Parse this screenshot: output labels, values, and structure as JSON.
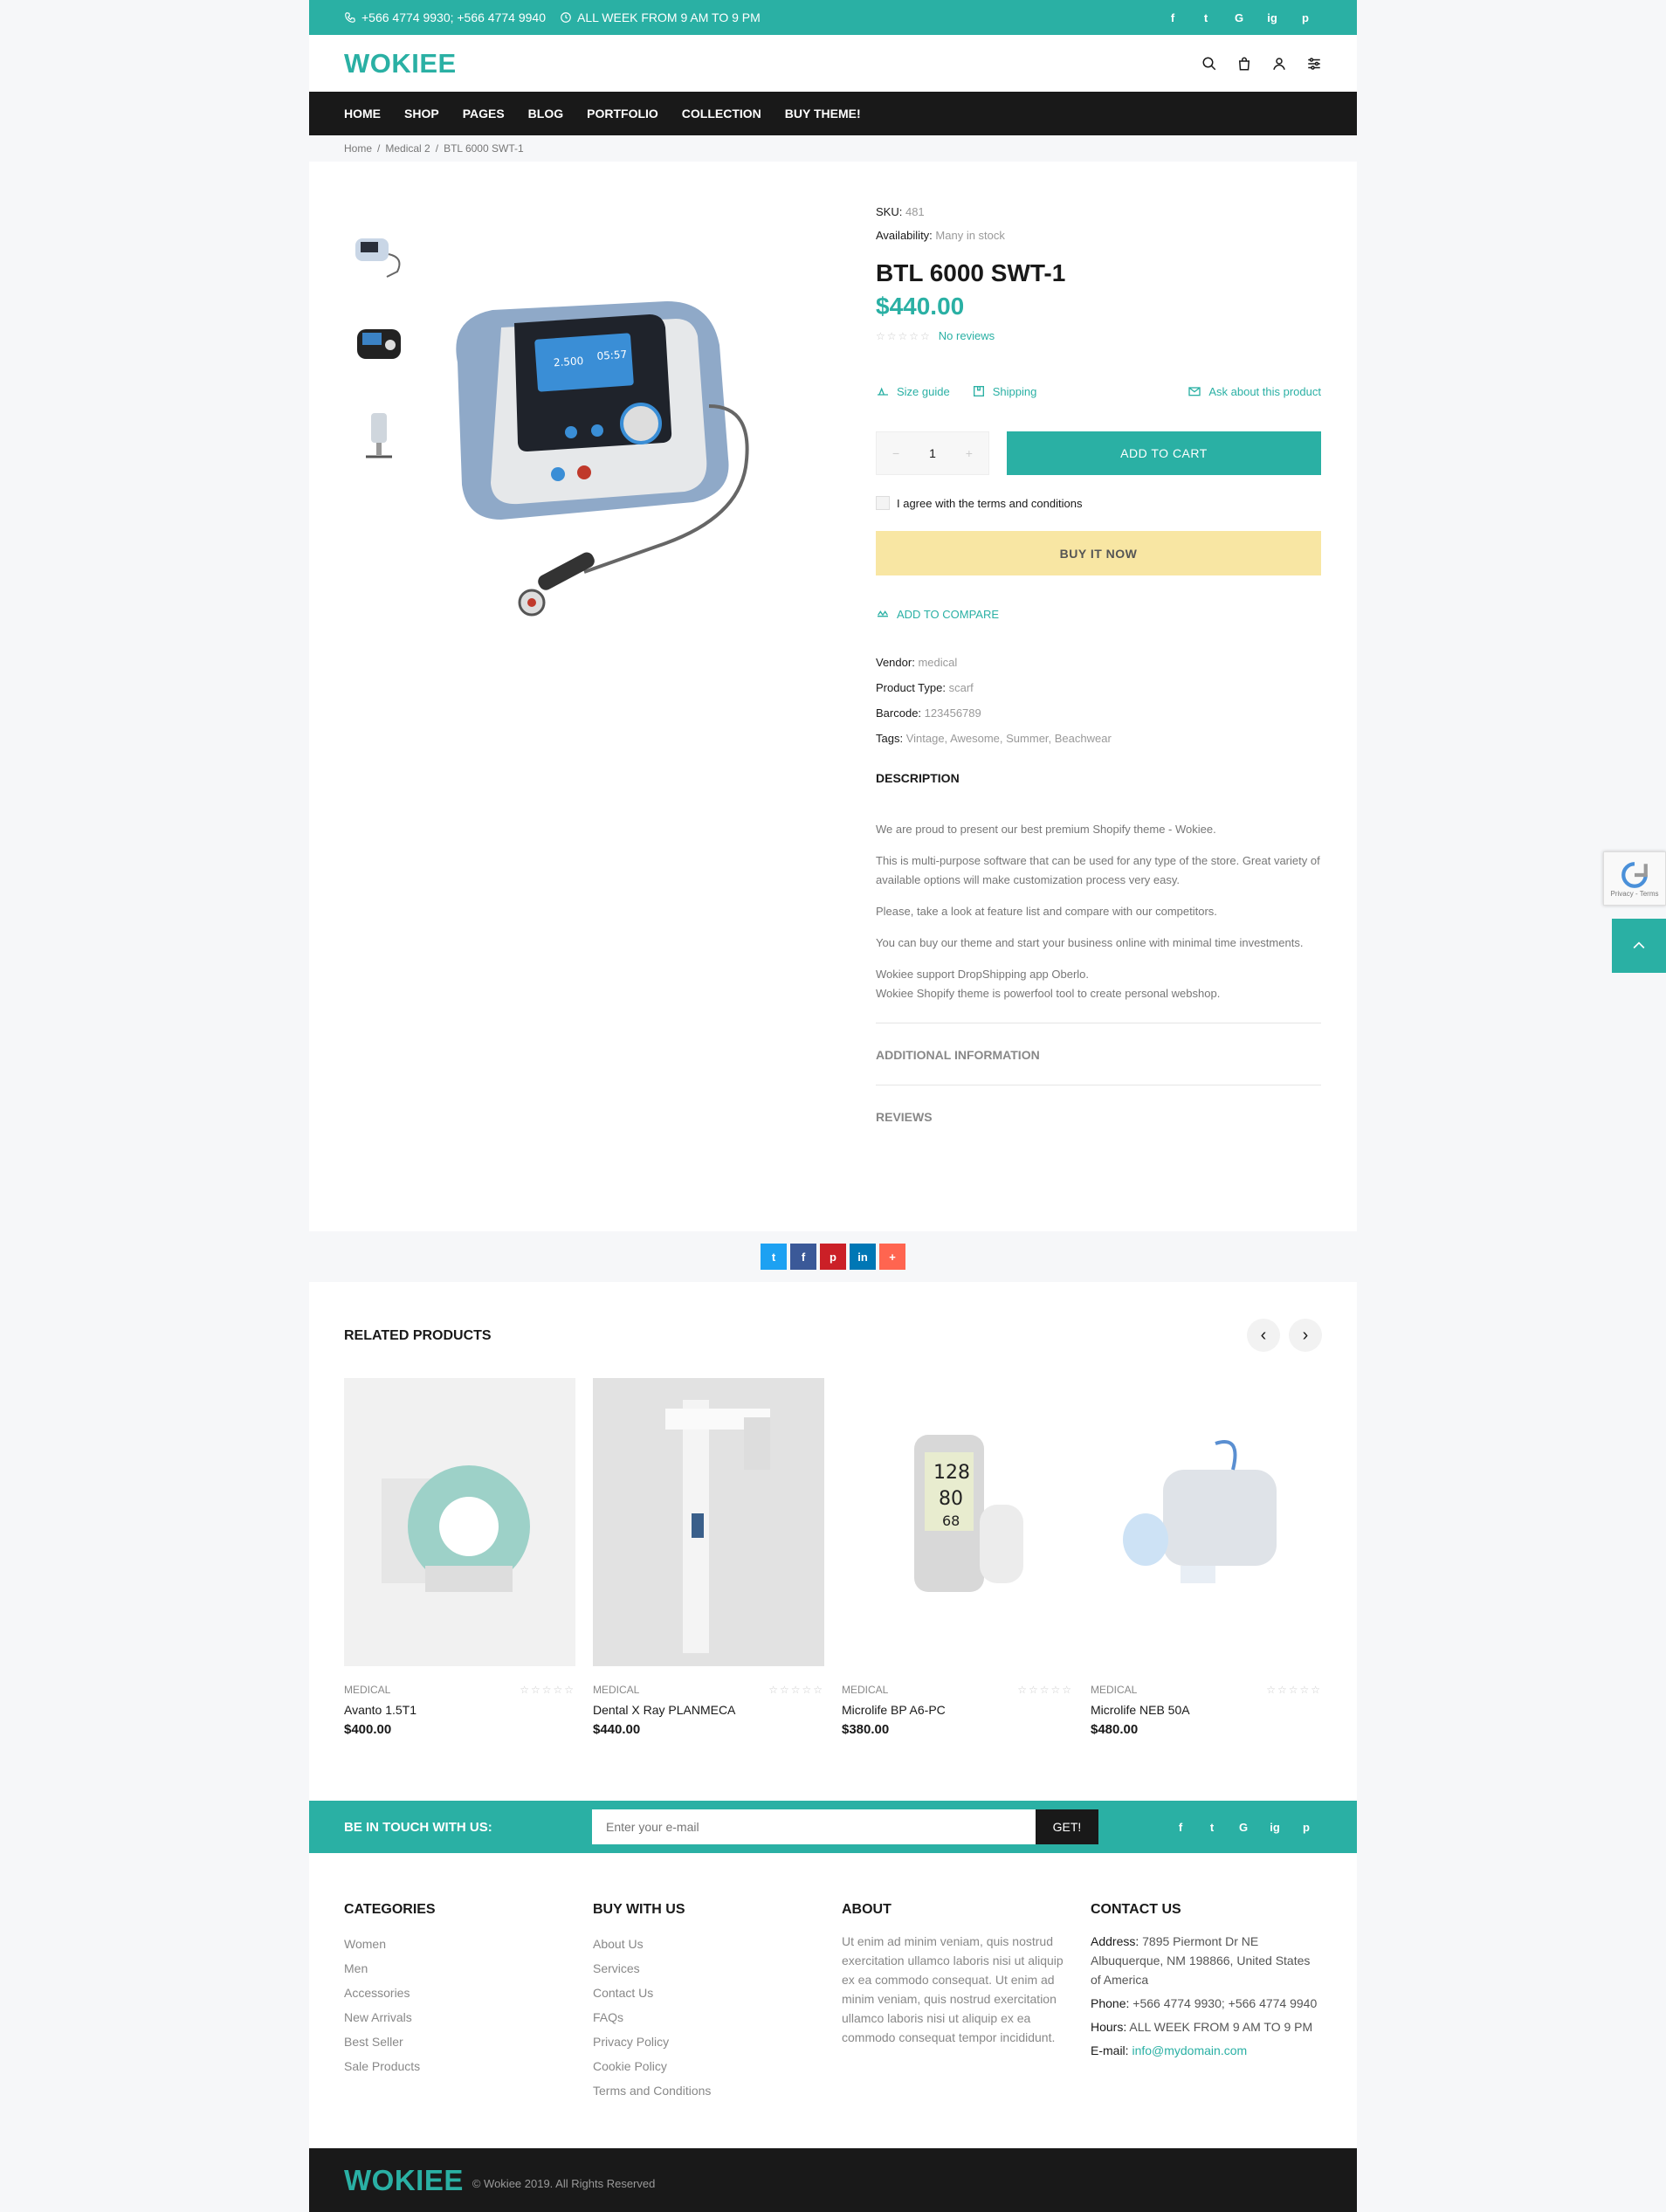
{
  "topbar": {
    "phone": "+566 4774 9930; +566 4774 9940",
    "hours": "ALL WEEK FROM 9 AM TO 9 PM",
    "social": [
      "f",
      "t",
      "G",
      "ig",
      "p"
    ]
  },
  "header": {
    "logo": "WOKIEE"
  },
  "nav": [
    "HOME",
    "SHOP",
    "PAGES",
    "BLOG",
    "PORTFOLIO",
    "COLLECTION",
    "BUY THEME!"
  ],
  "breadcrumb": [
    "Home",
    "Medical 2",
    "BTL 6000 SWT-1"
  ],
  "product": {
    "sku_label": "SKU:",
    "sku": "481",
    "availability_label": "Availability:",
    "availability": "Many in stock",
    "title": "BTL 6000 SWT-1",
    "price": "$440.00",
    "reviews": "No reviews",
    "size_guide": "Size guide",
    "shipping": "Shipping",
    "ask": "Ask about this product",
    "qty": "1",
    "qty_minus": "−",
    "qty_plus": "+",
    "add_to_cart": "ADD TO CART",
    "agree": "I agree with the terms and conditions",
    "buy_now": "BUY IT NOW",
    "compare": "ADD TO COMPARE",
    "vendor_label": "Vendor:",
    "vendor": "medical",
    "type_label": "Product Type:",
    "type": "scarf",
    "barcode_label": "Barcode:",
    "barcode": "123456789",
    "tags_label": "Tags:",
    "tags": "Vintage, Awesome, Summer, Beachwear",
    "description_title": "DESCRIPTION",
    "description": [
      "We are proud to present our best premium Shopify theme - Wokiee.",
      "This is multi-purpose software that can be used for any type of the store. Great variety of available options will make customization process very easy.",
      "Please, take a look at feature list and compare with our competitors.",
      "You can buy our theme and start your business online with minimal time investments.",
      "Wokiee support DropShipping app Oberlo.",
      "Wokiee Shopify theme is powerfool tool to create personal webshop."
    ],
    "additional_info": "ADDITIONAL INFORMATION",
    "reviews_tab": "REVIEWS"
  },
  "share": [
    "t",
    "f",
    "p",
    "in",
    "+"
  ],
  "colors": {
    "accent": "#2ab0a4",
    "dark": "#191919",
    "buy_now": "#f8e6a3",
    "twitter": "#1da1f2",
    "facebook": "#3b5998",
    "pinterest": "#cb2027",
    "linkedin": "#0077b5",
    "more": "#ff6550"
  },
  "related": {
    "title": "RELATED PRODUCTS",
    "items": [
      {
        "category": "MEDICAL",
        "name": "Avanto 1.5T1",
        "price": "$400.00"
      },
      {
        "category": "MEDICAL",
        "name": "Dental X Ray PLANMECA",
        "price": "$440.00"
      },
      {
        "category": "MEDICAL",
        "name": "Microlife BP A6-PC",
        "price": "$380.00"
      },
      {
        "category": "MEDICAL",
        "name": "Microlife NEB 50A",
        "price": "$480.00"
      }
    ]
  },
  "newsletter": {
    "label": "BE IN TOUCH WITH US:",
    "placeholder": "Enter your e-mail",
    "button": "GET!"
  },
  "footer": {
    "categories": {
      "title": "CATEGORIES",
      "items": [
        "Women",
        "Men",
        "Accessories",
        "New Arrivals",
        "Best Seller",
        "Sale Products"
      ]
    },
    "buy": {
      "title": "BUY WITH US",
      "items": [
        "About Us",
        "Services",
        "Contact Us",
        "FAQs",
        "Privacy Policy",
        "Cookie Policy",
        "Terms and Conditions"
      ]
    },
    "about": {
      "title": "ABOUT",
      "text": "Ut enim ad minim veniam, quis nostrud exercitation ullamco laboris nisi ut aliquip ex ea commodo consequat. Ut enim ad minim veniam, quis nostrud exercitation ullamco laboris nisi ut aliquip ex ea commodo consequat tempor incididunt."
    },
    "contact": {
      "title": "CONTACT US",
      "address_label": "Address:",
      "address": "7895 Piermont Dr NE Albuquerque, NM 198866, United States of America",
      "phone_label": "Phone:",
      "phone": "+566 4774 9930; +566 4774 9940",
      "hours_label": "Hours:",
      "hours": "ALL WEEK FROM 9 AM TO 9 PM",
      "email_label": "E-mail:",
      "email": "info@mydomain.com"
    },
    "copyright": "© Wokiee 2019. All Rights Reserved"
  },
  "recaptcha": "Privacy - Terms",
  "totop_icon": "chevron-up-icon"
}
